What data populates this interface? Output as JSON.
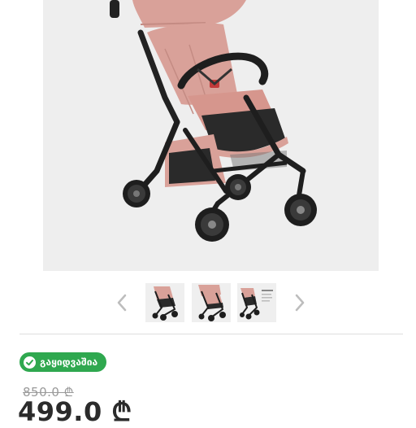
{
  "product": {
    "main_image_icon": "stroller-image",
    "thumbnails": [
      {
        "icon": "stroller-thumbnail"
      },
      {
        "icon": "stroller-thumbnail"
      },
      {
        "icon": "stroller-info-thumbnail"
      }
    ],
    "prev_icon": "chevron-left-icon",
    "next_icon": "chevron-right-icon"
  },
  "badge": {
    "label": "გაყიდვაშია",
    "icon": "check-circle-icon",
    "color": "#2fa84f"
  },
  "price": {
    "old": "850.0 ₾",
    "new": "499.0 ₾"
  },
  "colors": {
    "stroller_pink": "#d9a199",
    "frame": "#222222",
    "background": "#eeeeee"
  }
}
